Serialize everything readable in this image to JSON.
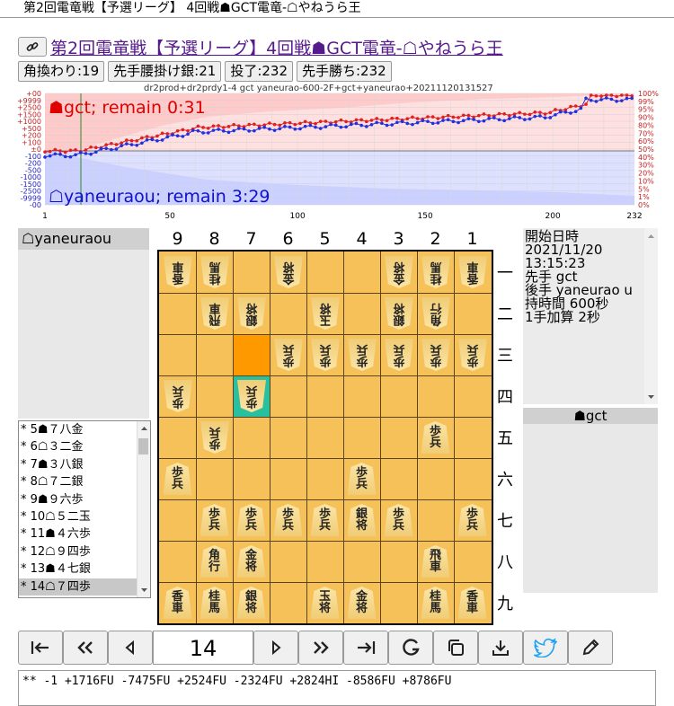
{
  "window_title": "第2回電竜戦【予選リーグ】 4回戦☗GCT電竜-☖やねうら王",
  "game_title": "第2回電竜戦【予選リーグ】4回戦☗GCT電竜-☖やねうら王",
  "tags": [
    "角換わり:19",
    "先手腰掛け銀:21",
    "投了:232",
    "先手勝ち:232"
  ],
  "graph": {
    "caption": "dr2prod+dr2prdy1-4 gct yaneurao-600-2F+gct+yaneurao+20211120131527",
    "sente_remain": "☗gct; remain 0:31",
    "gote_remain": "☖yaneuraou; remain 3:29",
    "left_ticks": [
      "+00",
      "+9999",
      "+2500",
      "+1500",
      "+1000",
      "+500",
      "+200",
      "+100",
      "±0",
      "-100",
      "-200",
      "-500",
      "-1000",
      "-1500",
      "-2500",
      "-9999",
      "-00"
    ],
    "right_ticks": [
      "100%",
      "99%",
      "95%",
      "90%",
      "80%",
      "70%",
      "60%",
      "50%",
      "40%",
      "30%",
      "20%",
      "10%",
      "5%",
      "1%",
      "0%"
    ],
    "x_ticks": [
      "1",
      "50",
      "100",
      "150",
      "200",
      "232"
    ]
  },
  "gote_player": "☖yaneuraou",
  "sente_player": "☗gct",
  "moves": [
    {
      "mark": "*",
      "text": " 5☗７八金"
    },
    {
      "mark": "*",
      "text": " 6☖３二金"
    },
    {
      "mark": "*",
      "text": " 7☗３八銀"
    },
    {
      "mark": "*",
      "text": " 8☖７二銀"
    },
    {
      "mark": "*",
      "text": " 9☗９六歩"
    },
    {
      "mark": "*",
      "text": "10☖５二玉"
    },
    {
      "mark": "*",
      "text": "11☗４六歩"
    },
    {
      "mark": "*",
      "text": "12☖９四歩"
    },
    {
      "mark": "*",
      "text": "13☗４七銀"
    },
    {
      "mark": "*",
      "text": "14☖７四歩"
    }
  ],
  "columns": [
    "9",
    "8",
    "7",
    "6",
    "5",
    "4",
    "3",
    "2",
    "1"
  ],
  "rows": [
    "一",
    "二",
    "三",
    "四",
    "五",
    "六",
    "七",
    "八",
    "九"
  ],
  "board": [
    {
      "c": 0,
      "r": 0,
      "p": "香車",
      "g": 1
    },
    {
      "c": 1,
      "r": 0,
      "p": "桂馬",
      "g": 1
    },
    {
      "c": 3,
      "r": 0,
      "p": "金将",
      "g": 1
    },
    {
      "c": 6,
      "r": 0,
      "p": "金将",
      "g": 1
    },
    {
      "c": 7,
      "r": 0,
      "p": "桂馬",
      "g": 1
    },
    {
      "c": 8,
      "r": 0,
      "p": "香車",
      "g": 1
    },
    {
      "c": 1,
      "r": 1,
      "p": "飛車",
      "g": 1
    },
    {
      "c": 2,
      "r": 1,
      "p": "銀将",
      "g": 1
    },
    {
      "c": 4,
      "r": 1,
      "p": "玉将",
      "g": 1
    },
    {
      "c": 6,
      "r": 1,
      "p": "銀将",
      "g": 1
    },
    {
      "c": 7,
      "r": 1,
      "p": "角行",
      "g": 1
    },
    {
      "c": 3,
      "r": 2,
      "p": "歩兵",
      "g": 1
    },
    {
      "c": 4,
      "r": 2,
      "p": "歩兵",
      "g": 1
    },
    {
      "c": 5,
      "r": 2,
      "p": "歩兵",
      "g": 1
    },
    {
      "c": 6,
      "r": 2,
      "p": "歩兵",
      "g": 1
    },
    {
      "c": 7,
      "r": 2,
      "p": "歩兵",
      "g": 1
    },
    {
      "c": 8,
      "r": 2,
      "p": "歩兵",
      "g": 1
    },
    {
      "c": 0,
      "r": 3,
      "p": "歩兵",
      "g": 1
    },
    {
      "c": 2,
      "r": 3,
      "p": "歩兵",
      "g": 1
    },
    {
      "c": 1,
      "r": 4,
      "p": "歩兵",
      "g": 1
    },
    {
      "c": 7,
      "r": 4,
      "p": "歩兵",
      "g": 0
    },
    {
      "c": 0,
      "r": 5,
      "p": "歩兵",
      "g": 0
    },
    {
      "c": 5,
      "r": 5,
      "p": "歩兵",
      "g": 0
    },
    {
      "c": 1,
      "r": 6,
      "p": "歩兵",
      "g": 0
    },
    {
      "c": 2,
      "r": 6,
      "p": "歩兵",
      "g": 0
    },
    {
      "c": 3,
      "r": 6,
      "p": "歩兵",
      "g": 0
    },
    {
      "c": 4,
      "r": 6,
      "p": "歩兵",
      "g": 0
    },
    {
      "c": 5,
      "r": 6,
      "p": "銀将",
      "g": 0
    },
    {
      "c": 6,
      "r": 6,
      "p": "歩兵",
      "g": 0
    },
    {
      "c": 8,
      "r": 6,
      "p": "歩兵",
      "g": 0
    },
    {
      "c": 1,
      "r": 7,
      "p": "角行",
      "g": 0
    },
    {
      "c": 2,
      "r": 7,
      "p": "金将",
      "g": 0
    },
    {
      "c": 7,
      "r": 7,
      "p": "飛車",
      "g": 0
    },
    {
      "c": 0,
      "r": 8,
      "p": "香車",
      "g": 0
    },
    {
      "c": 1,
      "r": 8,
      "p": "桂馬",
      "g": 0
    },
    {
      "c": 2,
      "r": 8,
      "p": "銀将",
      "g": 0
    },
    {
      "c": 4,
      "r": 8,
      "p": "玉将",
      "g": 0
    },
    {
      "c": 5,
      "r": 8,
      "p": "金将",
      "g": 0
    },
    {
      "c": 7,
      "r": 8,
      "p": "桂馬",
      "g": 0
    },
    {
      "c": 8,
      "r": 8,
      "p": "香車",
      "g": 0
    }
  ],
  "info": {
    "start_label": "開始日時",
    "start_value": "2021/11/20 13:15:23",
    "sente_label": "先手",
    "sente_value": "gct",
    "gote_label": "後手",
    "gote_value": "yaneurao u",
    "time_label": "持時間",
    "time_value": "600秒",
    "inc_label": "1手加算",
    "inc_value": "2秒"
  },
  "move_number": "14",
  "kif_text": "** -1 +1716FU -7475FU +2524FU -2324FU +2824HI -8586FU +8786FU",
  "colors": {
    "highlight_from": "#ff9900",
    "highlight_to": "#2abf9e",
    "twitter": "#1da1f2"
  },
  "icons": [
    "link-icon",
    "first-icon",
    "back10-icon",
    "prev-icon",
    "next-icon",
    "fwd10-icon",
    "last-icon",
    "reload-icon",
    "copy-icon",
    "download-icon",
    "twitter-icon",
    "edit-icon"
  ]
}
